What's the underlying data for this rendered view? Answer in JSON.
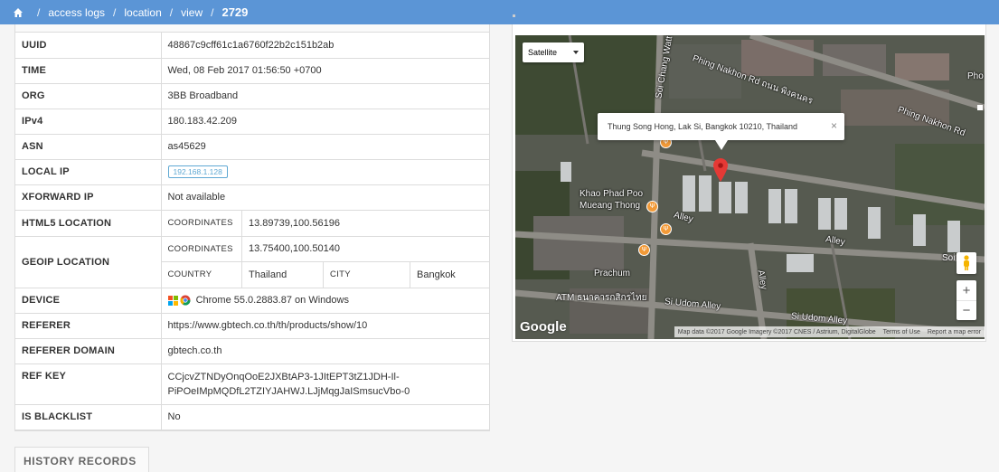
{
  "breadcrumb": {
    "items": [
      "access logs",
      "location",
      "view"
    ],
    "separator": "/",
    "current": "2729"
  },
  "info": {
    "uuid": {
      "label": "UUID",
      "value": "48867c9cff61c1a6760f22b2c151b2ab"
    },
    "time": {
      "label": "TIME",
      "value": "Wed, 08 Feb 2017 01:56:50 +0700"
    },
    "org": {
      "label": "ORG",
      "value": "3BB Broadband"
    },
    "ipv4": {
      "label": "IPv4",
      "value": "180.183.42.209"
    },
    "asn": {
      "label": "ASN",
      "value": "as45629"
    },
    "local_ip": {
      "label": "LOCAL IP",
      "value": "192.168.1.128"
    },
    "xforward_ip": {
      "label": "XFORWARD IP",
      "value": "Not available"
    },
    "html5_location": {
      "label": "HTML5 LOCATION",
      "coordinates_label": "COORDINATES",
      "coordinates": "13.89739,100.56196"
    },
    "geoip_location": {
      "label": "GEOIP LOCATION",
      "coordinates_label": "COORDINATES",
      "coordinates": "13.75400,100.50140",
      "country_label": "COUNTRY",
      "country": "Thailand",
      "city_label": "CITY",
      "city": "Bangkok"
    },
    "device": {
      "label": "DEVICE",
      "value": "Chrome 55.0.2883.87 on Windows",
      "icons": [
        "windows-icon",
        "chrome-icon"
      ]
    },
    "referer": {
      "label": "REFERER",
      "value": "https://www.gbtech.co.th/th/products/show/10"
    },
    "referer_domain": {
      "label": "REFERER DOMAIN",
      "value": "gbtech.co.th"
    },
    "ref_key": {
      "label": "REF KEY",
      "line1": "CCjcvZTNDyOnqOoE2JXBtAP3-1JItEPT3tZ1JDH-Il-",
      "line2": "PiPOeIMpMQDfL2TZIYJAHWJ.LJjMqgJaISmsucVbo-0"
    },
    "is_blacklist": {
      "label": "IS BLACKLIST",
      "value": "No"
    }
  },
  "history": {
    "title": "HISTORY RECORDS"
  },
  "map": {
    "type_selector": "Satellite",
    "info_window": "Thung Song Hong, Lak Si, Bangkok 10210, Thailand",
    "close_glyph": "×",
    "zoom_in": "+",
    "zoom_out": "−",
    "logo": "Google",
    "attribution": {
      "data": "Map data ©2017 Google Imagery ©2017 CNES / Astrium, DigitalGlobe",
      "terms": "Terms of Use",
      "report": "Report a map error"
    },
    "labels": {
      "phingnakhon1": "Phing Nakhon Rd ถนน พิงคนคร",
      "phingnakhon2": "Phing Nakhon Rd",
      "solchang": "Soi Chang Watt",
      "khaophad": "Khao Phad Poo",
      "mueang": "Mueang Thong",
      "alley1": "Alley",
      "alley2": "Alley",
      "alley3": "Alley",
      "prachum": "Prachum",
      "atm": "ATM ธนาคารกสิกรไทย",
      "siudom1": "Si Udom Alley",
      "siudom2": "Si Udom Alley",
      "soi": "Soi",
      "phon": "Pho"
    },
    "colors": {
      "pin": "#e53935",
      "poi": "#f29a38"
    }
  },
  "colors": {
    "topbar": "#5b95d6",
    "badge": "#5fa8d3"
  }
}
